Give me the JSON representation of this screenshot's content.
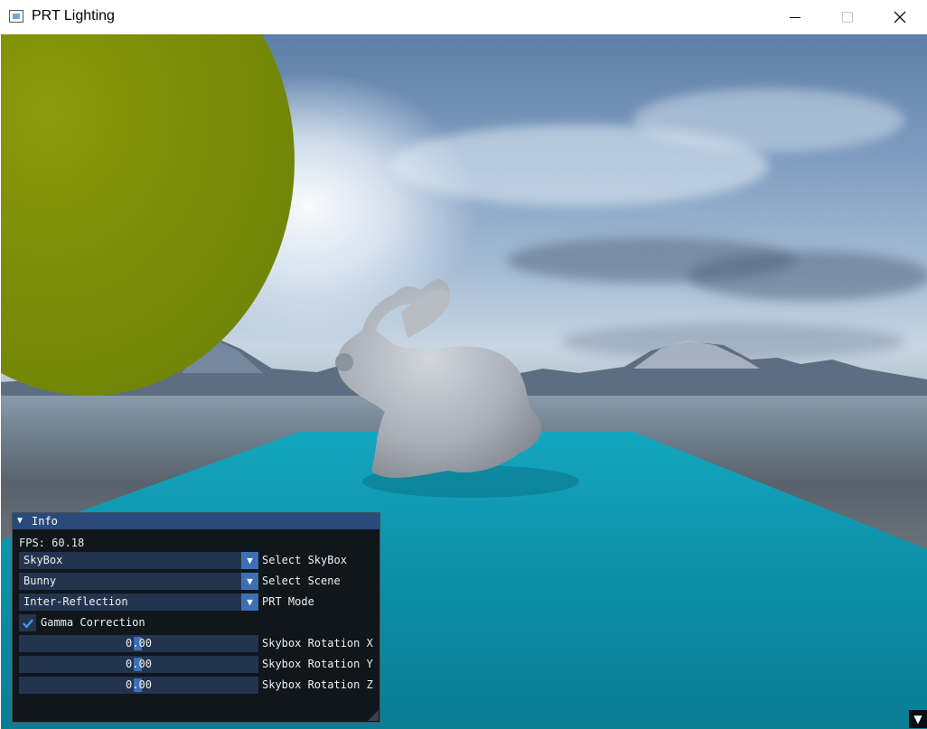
{
  "window": {
    "title": "PRT Lighting",
    "controls": {
      "minimize": "minimize",
      "maximize": "maximize",
      "close": "close"
    }
  },
  "scene": {
    "objects": [
      "skybox",
      "sphere",
      "bunny",
      "floor-plane"
    ],
    "colors": {
      "sphere": "#7a8c08",
      "floor": "#0f9fb7",
      "bunny": "#b9bfc6"
    }
  },
  "info_panel": {
    "title": "Info",
    "fps": "FPS: 60.18",
    "skybox_select": {
      "value": "SkyBox",
      "label": "Select SkyBox"
    },
    "scene_select": {
      "value": "Bunny",
      "label": "Select Scene"
    },
    "mode_select": {
      "value": "Inter-Reflection",
      "label": "PRT Mode"
    },
    "gamma": {
      "checked": true,
      "label": "Gamma Correction"
    },
    "rot_x": {
      "value": "0.00",
      "label": "Skybox Rotation X"
    },
    "rot_y": {
      "value": "0.00",
      "label": "Skybox Rotation Y"
    },
    "rot_z": {
      "value": "0.00",
      "label": "Skybox Rotation Z"
    }
  },
  "corner_button": {
    "icon": "triangle-down-icon"
  }
}
